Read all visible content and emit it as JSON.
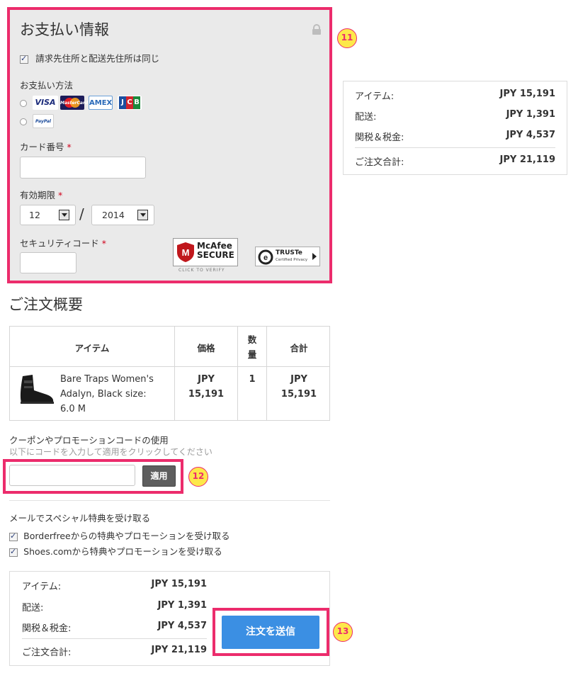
{
  "payment": {
    "title": "お支払い情報",
    "same_address_label": "請求先住所と配送先住所は同じ",
    "method_label": "お支払い方法",
    "cards": [
      "VISA",
      "MasterCard",
      "AMEX",
      "JCB"
    ],
    "paypal_label": "PayPal",
    "card_number_label": "カード番号",
    "expiry_label": "有効期限",
    "expiry_month": "12",
    "expiry_separator": "/",
    "expiry_year": "2014",
    "security_code_label": "セキュリティコード",
    "required_mark": "*",
    "mcafee": {
      "line1": "McAfee",
      "line2": "SECURE",
      "line3": "CLICK TO VERIFY"
    },
    "truste": {
      "line1": "TRUSTe",
      "line2": "Certified Privacy"
    }
  },
  "side_summary": {
    "rows": [
      {
        "label": "アイテム:",
        "value": "JPY 15,191"
      },
      {
        "label": "配送:",
        "value": "JPY 1,391"
      },
      {
        "label": "関税＆税金:",
        "value": "JPY 4,537"
      }
    ],
    "total": {
      "label": "ご注文合計:",
      "value": "JPY 21,119"
    }
  },
  "order_summary": {
    "title": "ご注文概要",
    "headers": {
      "item": "アイテム",
      "price": "価格",
      "qty_1": "数",
      "qty_2": "量",
      "total": "合計"
    },
    "item": {
      "name_1": "Bare Traps Women's",
      "name_2": "Adalyn, Black size:",
      "name_3": "6.0 M",
      "price_1": "JPY",
      "price_2": "15,191",
      "qty": "1",
      "total_1": "JPY",
      "total_2": "15,191"
    }
  },
  "coupon": {
    "title": "クーポンやプロモーションコードの使用",
    "hint": "以下にコードを入力して適用をクリックしてください",
    "apply_label": "適用"
  },
  "email": {
    "title": "メールでスペシャル特典を受け取る",
    "option1": "Borderfreeからの特典やプロモーションを受け取る",
    "option2": "Shoes.comから特典やプロモーションを受け取る"
  },
  "bottom_summary": {
    "rows": [
      {
        "label": "アイテム:",
        "value": "JPY 15,191"
      },
      {
        "label": "配送:",
        "value": "JPY 1,391"
      },
      {
        "label": "関税＆税金:",
        "value": "JPY 4,537"
      }
    ],
    "total": {
      "label": "ご注文合計:",
      "value": "JPY 21,119"
    },
    "submit_label": "注文を送信"
  },
  "badges": {
    "b11": "11",
    "b12": "12",
    "b13": "13"
  },
  "colors": {
    "highlight": "#ec2c6c",
    "badge_fill": "#fde84a",
    "submit": "#3b8fe3",
    "panel": "#eaeaea"
  },
  "icons": [
    "lock-icon",
    "checkbox-icon",
    "radio-icon",
    "shoe-thumbnail"
  ]
}
